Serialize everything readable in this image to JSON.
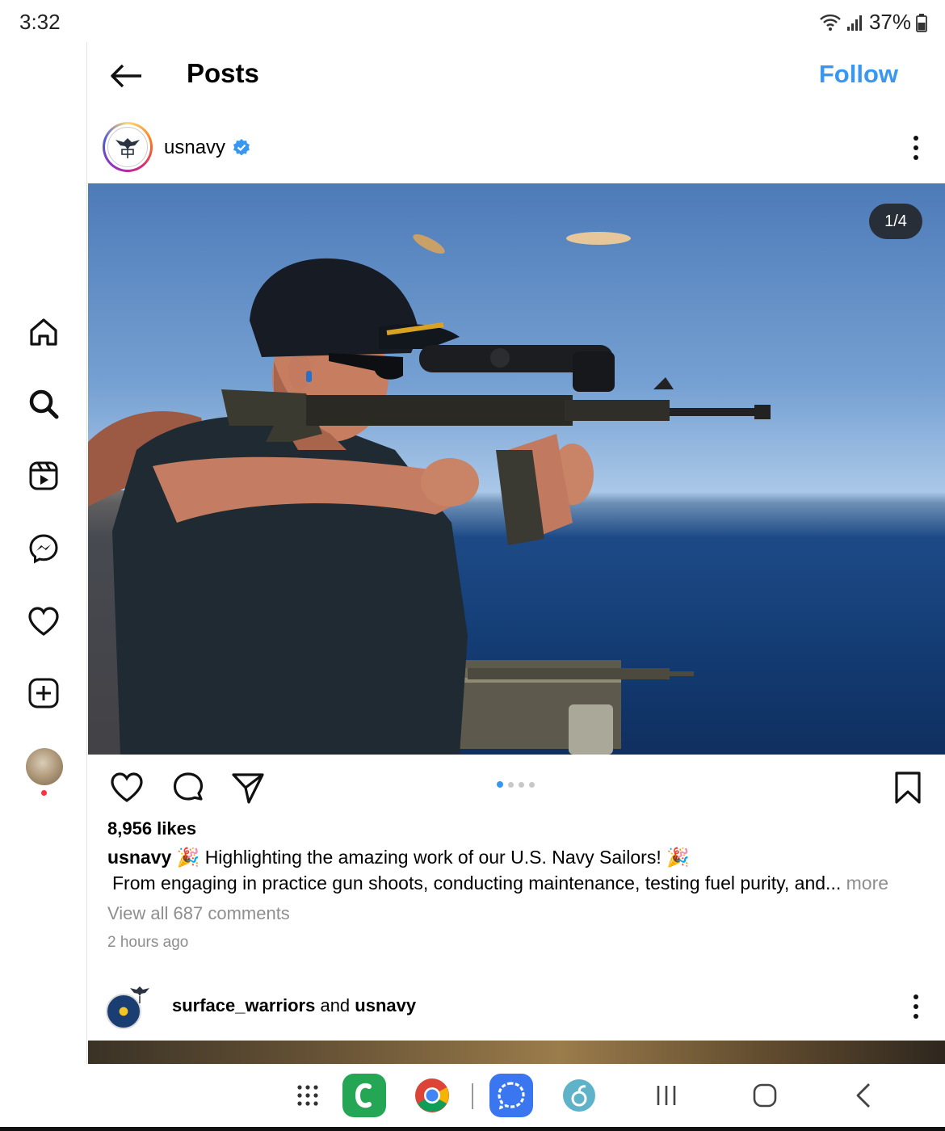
{
  "status_bar": {
    "time": "3:32",
    "battery": "37%"
  },
  "header": {
    "title": "Posts",
    "follow_label": "Follow"
  },
  "post": {
    "username": "usnavy",
    "counter": "1/4",
    "page_index": 1,
    "page_count": 4,
    "likes": "8,956 likes",
    "caption_user": "usnavy",
    "caption_text": "Highlighting the amazing work of our U.S. Navy Sailors!",
    "caption_more_line": "From engaging in practice gun shoots, conducting maintenance, testing fuel purity, and...",
    "more_label": "more",
    "view_comments": "View all 687 comments",
    "time_ago": "2 hours ago"
  },
  "next_post": {
    "user1": "surface_warriors",
    "joiner": "and",
    "user2": "usnavy"
  },
  "nav_icons": [
    "home-icon",
    "search-icon",
    "reels-icon",
    "messenger-icon",
    "heart-icon",
    "create-icon",
    "profile-avatar"
  ],
  "dock_icons": [
    "app-drawer-icon",
    "phone-app-icon",
    "chrome-icon",
    "signal-icon",
    "app-icon",
    "recents-icon",
    "home-nav-icon",
    "back-nav-icon"
  ],
  "colors": {
    "accent": "#3897f0",
    "notification": "#ff3040",
    "verified": "#3897f0"
  }
}
